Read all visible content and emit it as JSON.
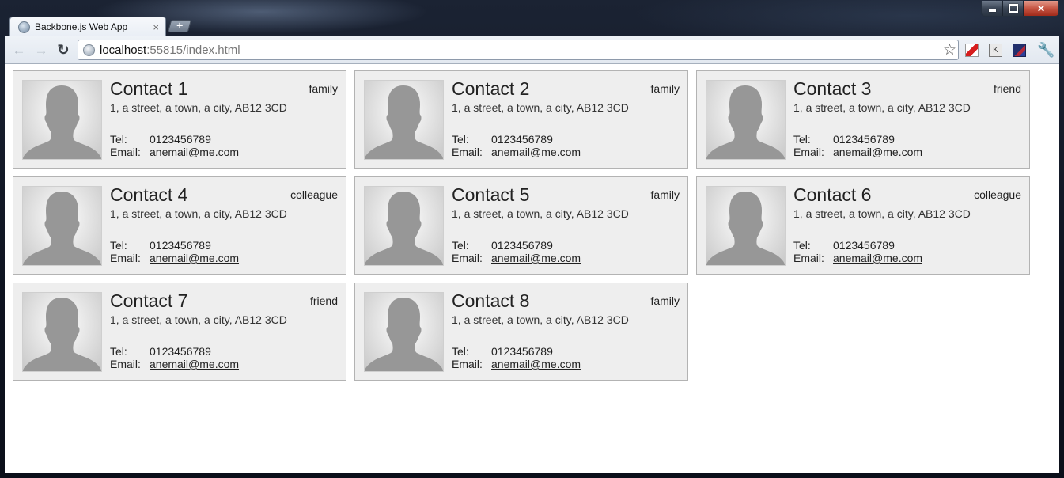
{
  "window": {
    "controls": {
      "minimize": "minimize",
      "maximize": "maximize",
      "close": "close"
    }
  },
  "tab": {
    "title": "Backbone.js Web App",
    "close_glyph": "×",
    "new_tab_glyph": "+"
  },
  "toolbar": {
    "back_glyph": "←",
    "forward_glyph": "→",
    "reload_glyph": "↻",
    "url_host": "localhost",
    "url_rest": ":55815/index.html",
    "star_glyph": "☆",
    "ext2_glyph": "K",
    "wrench_glyph": "🔧"
  },
  "labels": {
    "tel": "Tel:",
    "email": "Email:"
  },
  "contacts": [
    {
      "name": "Contact 1",
      "type": "family",
      "address": "1, a street, a town, a city, AB12 3CD",
      "tel": "0123456789",
      "email": "anemail@me.com"
    },
    {
      "name": "Contact 2",
      "type": "family",
      "address": "1, a street, a town, a city, AB12 3CD",
      "tel": "0123456789",
      "email": "anemail@me.com"
    },
    {
      "name": "Contact 3",
      "type": "friend",
      "address": "1, a street, a town, a city, AB12 3CD",
      "tel": "0123456789",
      "email": "anemail@me.com"
    },
    {
      "name": "Contact 4",
      "type": "colleague",
      "address": "1, a street, a town, a city, AB12 3CD",
      "tel": "0123456789",
      "email": "anemail@me.com"
    },
    {
      "name": "Contact 5",
      "type": "family",
      "address": "1, a street, a town, a city, AB12 3CD",
      "tel": "0123456789",
      "email": "anemail@me.com"
    },
    {
      "name": "Contact 6",
      "type": "colleague",
      "address": "1, a street, a town, a city, AB12 3CD",
      "tel": "0123456789",
      "email": "anemail@me.com"
    },
    {
      "name": "Contact 7",
      "type": "friend",
      "address": "1, a street, a town, a city, AB12 3CD",
      "tel": "0123456789",
      "email": "anemail@me.com"
    },
    {
      "name": "Contact 8",
      "type": "family",
      "address": "1, a street, a town, a city, AB12 3CD",
      "tel": "0123456789",
      "email": "anemail@me.com"
    }
  ]
}
